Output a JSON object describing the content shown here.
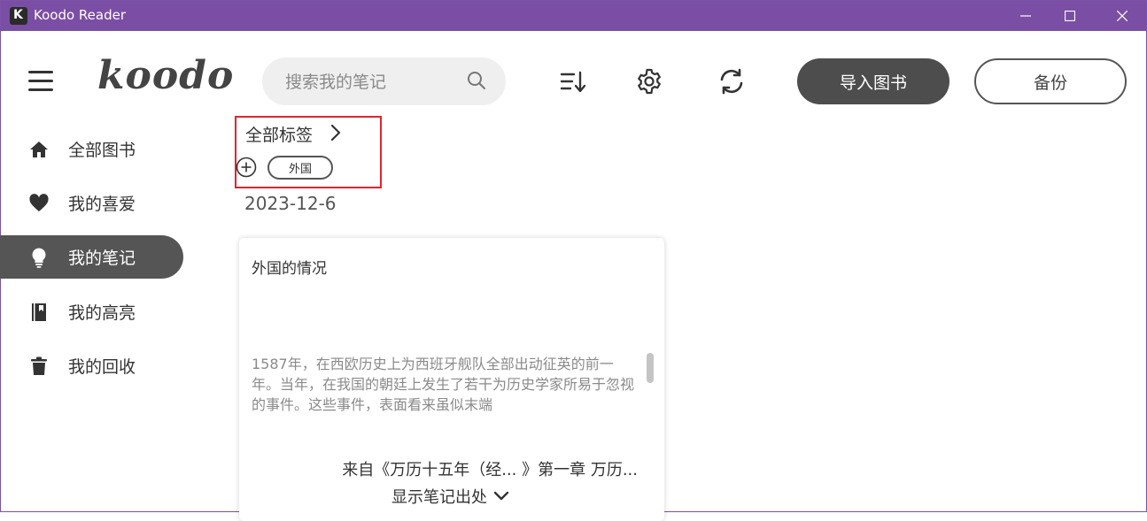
{
  "titlebar": {
    "title": "Koodo Reader",
    "color": "#7b4ea5"
  },
  "header": {
    "logo_text": "koodo",
    "search_placeholder": "搜索我的笔记",
    "import_label": "导入图书",
    "backup_label": "备份"
  },
  "sidebar": {
    "items": [
      {
        "label": "全部图书",
        "icon": "home-icon"
      },
      {
        "label": "我的喜爱",
        "icon": "heart-icon"
      },
      {
        "label": "我的笔记",
        "icon": "lightbulb-icon",
        "active": true
      },
      {
        "label": "我的高亮",
        "icon": "bookmark-book-icon"
      },
      {
        "label": "我的回收",
        "icon": "trash-icon"
      }
    ]
  },
  "tags": {
    "title": "全部标签",
    "items": [
      "外国"
    ]
  },
  "notes": {
    "date": "2023-12-6",
    "card": {
      "title": "外国的情况",
      "excerpt": "1587年，在西欧历史上为西班牙舰队全部出动征英的前一年。当年，在我国的朝廷上发生了若干为历史学家所易于忽视的事件。这些事件，表面看来虽似末端",
      "source": "来自《万历十五年（经...  》第一章   万历...",
      "show_source_label": "显示笔记出处"
    }
  }
}
